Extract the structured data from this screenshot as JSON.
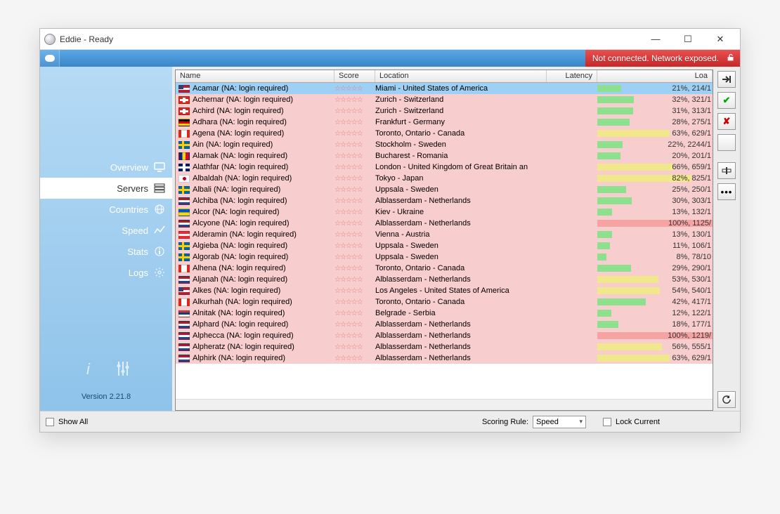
{
  "window": {
    "title": "Eddie - Ready"
  },
  "status": {
    "message": "Not connected. Network exposed."
  },
  "sidebar": {
    "items": [
      {
        "label": "Overview",
        "icon": "monitor"
      },
      {
        "label": "Servers",
        "icon": "servers"
      },
      {
        "label": "Countries",
        "icon": "globe"
      },
      {
        "label": "Speed",
        "icon": "speed"
      },
      {
        "label": "Stats",
        "icon": "info"
      },
      {
        "label": "Logs",
        "icon": "gear"
      }
    ],
    "version": "Version 2.21.8"
  },
  "columns": {
    "name": "Name",
    "score": "Score",
    "location": "Location",
    "latency": "Latency",
    "load": "Loa"
  },
  "stars": "☆☆☆☆☆",
  "servers": [
    {
      "flag": "us",
      "name": "Acamar (NA: login required)",
      "location": "Miami - United States of America",
      "load": "21%, 214/1",
      "pct": 21,
      "sel": true
    },
    {
      "flag": "ch",
      "name": "Achernar (NA: login required)",
      "location": "Zurich - Switzerland",
      "load": "32%, 321/1",
      "pct": 32
    },
    {
      "flag": "ch",
      "name": "Achird (NA: login required)",
      "location": "Zurich - Switzerland",
      "load": "31%, 313/1",
      "pct": 31
    },
    {
      "flag": "de",
      "name": "Adhara (NA: login required)",
      "location": "Frankfurt - Germany",
      "load": "28%, 275/1",
      "pct": 28
    },
    {
      "flag": "ca",
      "name": "Agena (NA: login required)",
      "location": "Toronto, Ontario - Canada",
      "load": "63%, 629/1",
      "pct": 63,
      "y": true
    },
    {
      "flag": "se",
      "name": "Ain (NA: login required)",
      "location": "Stockholm - Sweden",
      "load": "22%, 2244/1",
      "pct": 22
    },
    {
      "flag": "ro",
      "name": "Alamak (NA: login required)",
      "location": "Bucharest - Romania",
      "load": "20%, 201/1",
      "pct": 20
    },
    {
      "flag": "gb",
      "name": "Alathfar (NA: login required)",
      "location": "London - United Kingdom of Great Britain an",
      "load": "66%, 659/1",
      "pct": 66,
      "y": true
    },
    {
      "flag": "jp",
      "name": "Albaldah (NA: login required)",
      "location": "Tokyo - Japan",
      "load": "82%, 825/1",
      "pct": 82,
      "y": true
    },
    {
      "flag": "se",
      "name": "Albali (NA: login required)",
      "location": "Uppsala - Sweden",
      "load": "25%, 250/1",
      "pct": 25
    },
    {
      "flag": "nl",
      "name": "Alchiba (NA: login required)",
      "location": "Alblasserdam - Netherlands",
      "load": "30%, 303/1",
      "pct": 30
    },
    {
      "flag": "ua",
      "name": "Alcor (NA: login required)",
      "location": "Kiev - Ukraine",
      "load": "13%, 132/1",
      "pct": 13
    },
    {
      "flag": "nl",
      "name": "Alcyone (NA: login required)",
      "location": "Alblasserdam - Netherlands",
      "load": "100%, 1125/",
      "pct": 100,
      "h": true
    },
    {
      "flag": "at",
      "name": "Alderamin (NA: login required)",
      "location": "Vienna - Austria",
      "load": "13%, 130/1",
      "pct": 13
    },
    {
      "flag": "se",
      "name": "Algieba (NA: login required)",
      "location": "Uppsala - Sweden",
      "load": "11%, 106/1",
      "pct": 11
    },
    {
      "flag": "se",
      "name": "Algorab (NA: login required)",
      "location": "Uppsala - Sweden",
      "load": "8%, 78/10",
      "pct": 8
    },
    {
      "flag": "ca",
      "name": "Alhena (NA: login required)",
      "location": "Toronto, Ontario - Canada",
      "load": "29%, 290/1",
      "pct": 29
    },
    {
      "flag": "nl",
      "name": "Aljanah (NA: login required)",
      "location": "Alblasserdam - Netherlands",
      "load": "53%, 530/1",
      "pct": 53,
      "y": true
    },
    {
      "flag": "us",
      "name": "Alkes (NA: login required)",
      "location": "Los Angeles - United States of America",
      "load": "54%, 540/1",
      "pct": 54,
      "y": true
    },
    {
      "flag": "ca",
      "name": "Alkurhah (NA: login required)",
      "location": "Toronto, Ontario - Canada",
      "load": "42%, 417/1",
      "pct": 42
    },
    {
      "flag": "rs",
      "name": "Alnitak (NA: login required)",
      "location": "Belgrade - Serbia",
      "load": "12%, 122/1",
      "pct": 12
    },
    {
      "flag": "nl",
      "name": "Alphard (NA: login required)",
      "location": "Alblasserdam - Netherlands",
      "load": "18%, 177/1",
      "pct": 18
    },
    {
      "flag": "nl",
      "name": "Alphecca (NA: login required)",
      "location": "Alblasserdam - Netherlands",
      "load": "100%, 1219/",
      "pct": 100,
      "h": true
    },
    {
      "flag": "nl",
      "name": "Alpheratz (NA: login required)",
      "location": "Alblasserdam - Netherlands",
      "load": "56%, 555/1",
      "pct": 56,
      "y": true
    },
    {
      "flag": "nl",
      "name": "Alphirk (NA: login required)",
      "location": "Alblasserdam - Netherlands",
      "load": "63%, 629/1",
      "pct": 63,
      "y": true
    }
  ],
  "footer": {
    "show_all": "Show All",
    "scoring_label": "Scoring Rule:",
    "scoring_value": "Speed",
    "lock_current": "Lock Current"
  }
}
